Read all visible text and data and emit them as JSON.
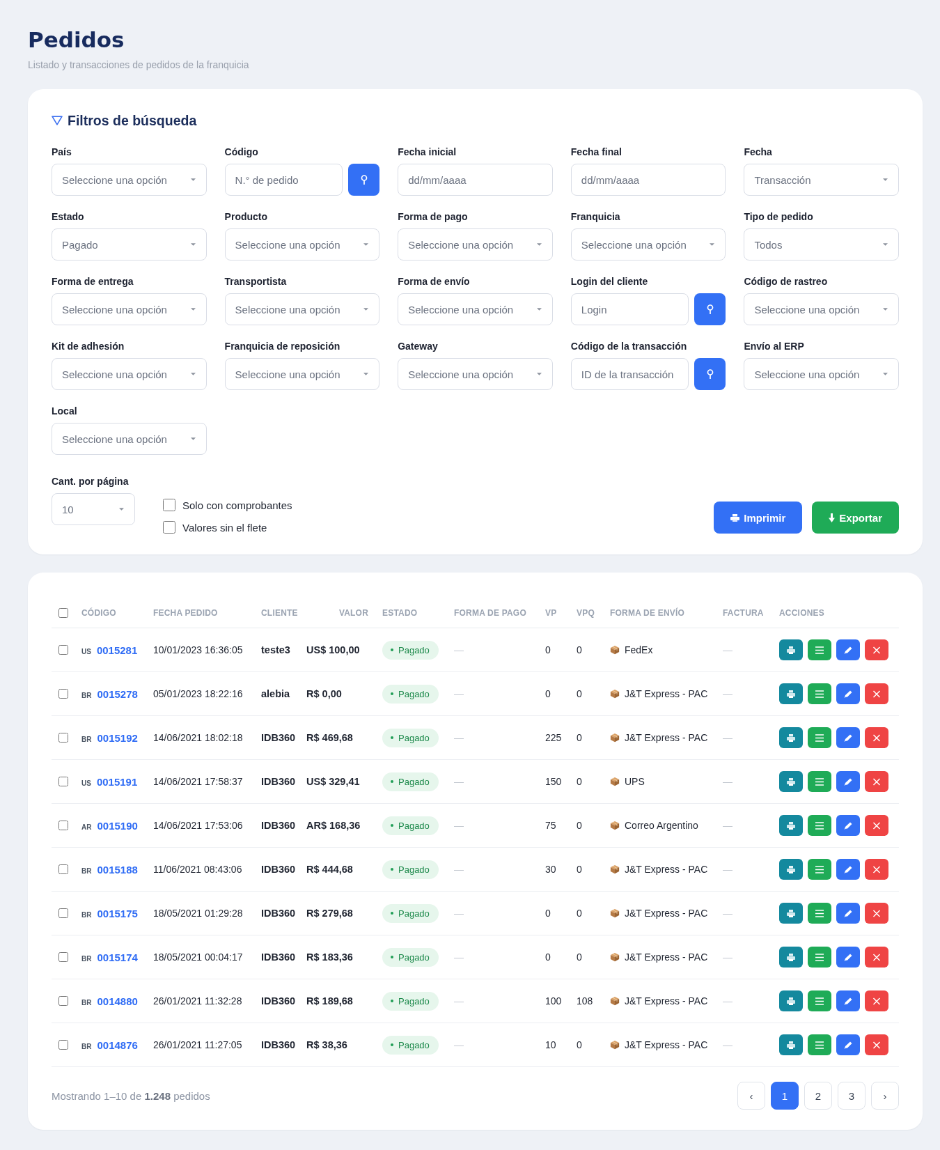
{
  "header": {
    "title": "Pedidos",
    "subtitle": "Listado y transacciones de pedidos de la franquicia"
  },
  "filters": {
    "title": "Filtros de búsqueda",
    "fields": [
      {
        "label": "País",
        "kind": "select",
        "value": "Seleccione una opción"
      },
      {
        "label": "Código",
        "kind": "search",
        "placeholder": "N.° de pedido"
      },
      {
        "label": "Fecha inicial",
        "kind": "date",
        "placeholder": "dd/mm/aaaa"
      },
      {
        "label": "Fecha final",
        "kind": "date",
        "placeholder": "dd/mm/aaaa"
      },
      {
        "label": "Fecha",
        "kind": "select",
        "value": "Transacción"
      },
      {
        "label": "Estado",
        "kind": "select",
        "value": "Pagado"
      },
      {
        "label": "Producto",
        "kind": "select",
        "value": "Seleccione una opción"
      },
      {
        "label": "Forma de pago",
        "kind": "select",
        "value": "Seleccione una opción"
      },
      {
        "label": "Franquicia",
        "kind": "select",
        "value": "Seleccione una opción"
      },
      {
        "label": "Tipo de pedido",
        "kind": "select",
        "value": "Todos"
      },
      {
        "label": "Forma de entrega",
        "kind": "select",
        "value": "Seleccione una opción"
      },
      {
        "label": "Transportista",
        "kind": "select",
        "value": "Seleccione una opción"
      },
      {
        "label": "Forma de envío",
        "kind": "select",
        "value": "Seleccione una opción"
      },
      {
        "label": "Login del cliente",
        "kind": "search",
        "placeholder": "Login"
      },
      {
        "label": "Código de rastreo",
        "kind": "select",
        "value": "Seleccione una opción"
      },
      {
        "label": "Kit de adhesión",
        "kind": "select",
        "value": "Seleccione una opción"
      },
      {
        "label": "Franquicia de reposición",
        "kind": "select",
        "value": "Seleccione una opción"
      },
      {
        "label": "Gateway",
        "kind": "select",
        "value": "Seleccione una opción"
      },
      {
        "label": "Código de la transacción",
        "kind": "search",
        "placeholder": "ID de la transacción"
      },
      {
        "label": "Envío al ERP",
        "kind": "select",
        "value": "Seleccione una opción"
      },
      {
        "label": "Local",
        "kind": "select",
        "value": "Seleccione una opción"
      }
    ],
    "per_page": {
      "label": "Cant. por página",
      "value": "10"
    },
    "options": [
      {
        "label": "Solo con comprobantes",
        "checked": false
      },
      {
        "label": "Valores sin el flete",
        "checked": false
      }
    ],
    "buttons": [
      {
        "label": "Imprimir",
        "kind": "print"
      },
      {
        "label": "Exportar",
        "kind": "export"
      }
    ]
  },
  "table": {
    "select_all_checked": false,
    "columns": [
      "CÓDIGO",
      "FECHA PEDIDO",
      "CLIENTE",
      "VALOR",
      "ESTADO",
      "FORMA DE PAGO",
      "VP",
      "VPQ",
      "FORMA DE ENVÍO",
      "FACTURA",
      "ACCIONES"
    ],
    "rows": [
      {
        "checked": false,
        "country": "US",
        "code": "0015281",
        "date": "10/01/2023 16:36:05",
        "client": "teste3",
        "value": "US$ 100,00",
        "status": "Pagado",
        "payment": "—",
        "vp": "0",
        "vpq": "0",
        "shipping": "FedEx",
        "invoice": "—"
      },
      {
        "checked": false,
        "country": "BR",
        "code": "0015278",
        "date": "05/01/2023 18:22:16",
        "client": "alebia",
        "value": "R$ 0,00",
        "status": "Pagado",
        "payment": "—",
        "vp": "0",
        "vpq": "0",
        "shipping": "J&T Express - PAC",
        "invoice": "—"
      },
      {
        "checked": false,
        "country": "BR",
        "code": "0015192",
        "date": "14/06/2021 18:02:18",
        "client": "IDB360",
        "value": "R$ 469,68",
        "status": "Pagado",
        "payment": "—",
        "vp": "225",
        "vpq": "0",
        "shipping": "J&T Express - PAC",
        "invoice": "—"
      },
      {
        "checked": false,
        "country": "US",
        "code": "0015191",
        "date": "14/06/2021 17:58:37",
        "client": "IDB360",
        "value": "US$ 329,41",
        "status": "Pagado",
        "payment": "—",
        "vp": "150",
        "vpq": "0",
        "shipping": "UPS",
        "invoice": "—"
      },
      {
        "checked": false,
        "country": "AR",
        "code": "0015190",
        "date": "14/06/2021 17:53:06",
        "client": "IDB360",
        "value": "AR$ 168,36",
        "status": "Pagado",
        "payment": "—",
        "vp": "75",
        "vpq": "0",
        "shipping": "Correo Argentino",
        "invoice": "—"
      },
      {
        "checked": false,
        "country": "BR",
        "code": "0015188",
        "date": "11/06/2021 08:43:06",
        "client": "IDB360",
        "value": "R$ 444,68",
        "status": "Pagado",
        "payment": "—",
        "vp": "30",
        "vpq": "0",
        "shipping": "J&T Express - PAC",
        "invoice": "—"
      },
      {
        "checked": false,
        "country": "BR",
        "code": "0015175",
        "date": "18/05/2021 01:29:28",
        "client": "IDB360",
        "value": "R$ 279,68",
        "status": "Pagado",
        "payment": "—",
        "vp": "0",
        "vpq": "0",
        "shipping": "J&T Express - PAC",
        "invoice": "—"
      },
      {
        "checked": false,
        "country": "BR",
        "code": "0015174",
        "date": "18/05/2021 00:04:17",
        "client": "IDB360",
        "value": "R$ 183,36",
        "status": "Pagado",
        "payment": "—",
        "vp": "0",
        "vpq": "0",
        "shipping": "J&T Express - PAC",
        "invoice": "—"
      },
      {
        "checked": false,
        "country": "BR",
        "code": "0014880",
        "date": "26/01/2021 11:32:28",
        "client": "IDB360",
        "value": "R$ 189,68",
        "status": "Pagado",
        "payment": "—",
        "vp": "100",
        "vpq": "108",
        "shipping": "J&T Express - PAC",
        "invoice": "—"
      },
      {
        "checked": false,
        "country": "BR",
        "code": "0014876",
        "date": "26/01/2021 11:27:05",
        "client": "IDB360",
        "value": "R$ 38,36",
        "status": "Pagado",
        "payment": "—",
        "vp": "10",
        "vpq": "0",
        "shipping": "J&T Express - PAC",
        "invoice": "—"
      }
    ],
    "summary": "Mostrando 1–10 de **1.248** pedidos",
    "pagination": [
      {
        "label": "‹",
        "selected": false
      },
      {
        "label": "1",
        "selected": true
      },
      {
        "label": "2",
        "selected": false
      },
      {
        "label": "3",
        "selected": false
      },
      {
        "label": "›",
        "selected": false
      }
    ]
  }
}
